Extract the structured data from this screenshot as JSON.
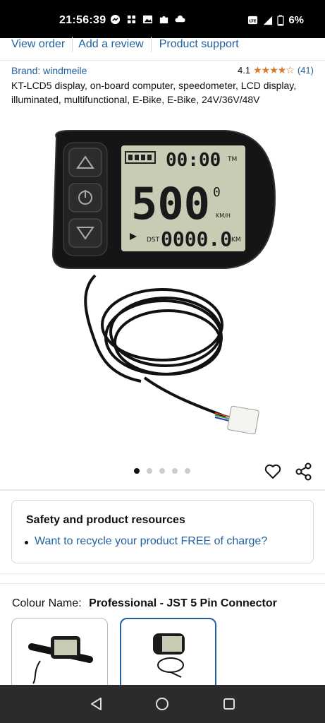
{
  "status_bar": {
    "time": "21:56:39",
    "battery": "6%",
    "network": "4G",
    "icons": [
      "messenger-icon",
      "grid-app-icon",
      "gallery-icon",
      "puzzle-icon",
      "cloud-icon",
      "volte-icon",
      "signal-icon",
      "battery-icon"
    ]
  },
  "top_links": [
    "View order",
    "Add a review",
    "Product support"
  ],
  "product": {
    "brand": "Brand: windmeile",
    "rating": "4.1",
    "stars": "★★★★☆",
    "rating_count": "(41)",
    "title": "KT-LCD5 display, on-board computer, speedometer, LCD display, illuminated, multifunctional, E-Bike, E-Bike, 24V/36V/48V"
  },
  "lcd": {
    "time": "00:00",
    "time_unit": "TM",
    "speed": "500",
    "speed_small": "0",
    "speed_unit": "KM/H",
    "distance": "0000.0",
    "distance_label": "DST",
    "distance_unit": "KM"
  },
  "carousel": {
    "count": 5,
    "active": 0
  },
  "safety": {
    "title": "Safety and product resources",
    "link": "Want to recycle your product FREE of charge?"
  },
  "colour": {
    "label": "Colour Name:",
    "value": "Professional - JST 5 Pin Connector"
  },
  "colors": {
    "link": "#2162a1",
    "star": "#de7921",
    "selected_border": "#2162a1"
  }
}
